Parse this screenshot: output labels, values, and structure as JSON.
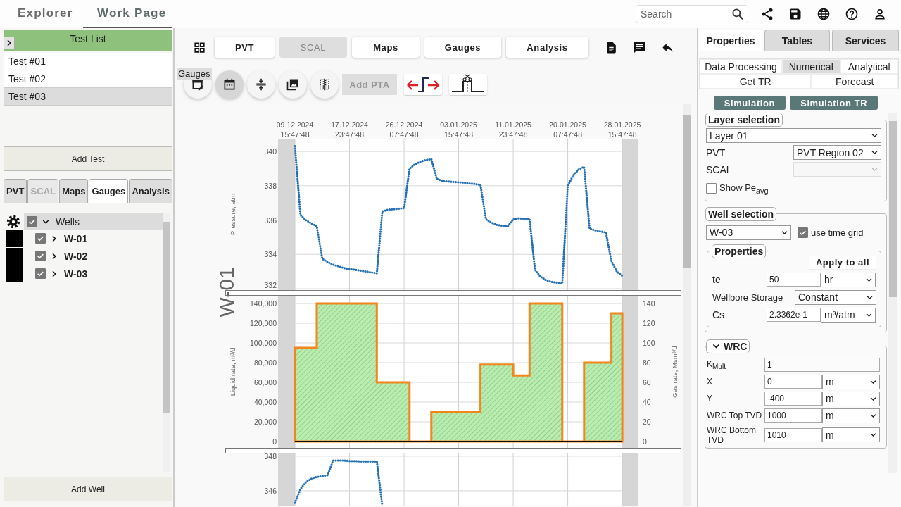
{
  "header": {
    "tabs": [
      {
        "label": "Explorer",
        "selected": false
      },
      {
        "label": "Work Page",
        "selected": true
      }
    ],
    "search": {
      "placeholder": "Search"
    }
  },
  "test_list": {
    "title": "Test List",
    "items": [
      {
        "label": "Test #01",
        "selected": false
      },
      {
        "label": "Test #02",
        "selected": false
      },
      {
        "label": "Test #03",
        "selected": true
      }
    ],
    "add_button": "Add Test"
  },
  "module_tabs": [
    {
      "label": "PVT",
      "selected": false,
      "disabled": false
    },
    {
      "label": "SCAL",
      "selected": false,
      "disabled": true
    },
    {
      "label": "Maps",
      "selected": false,
      "disabled": false
    },
    {
      "label": "Gauges",
      "selected": true,
      "disabled": false
    },
    {
      "label": "Analysis",
      "selected": false,
      "disabled": false
    }
  ],
  "wells_tree": {
    "label": "Wells",
    "checked": true,
    "expanded": true,
    "selected": true,
    "children": [
      {
        "label": "W-01",
        "checked": true,
        "expanded": false,
        "selected": false,
        "color": "#000000"
      },
      {
        "label": "W-02",
        "checked": true,
        "expanded": false,
        "selected": false,
        "color": "#000000"
      },
      {
        "label": "W-03",
        "checked": true,
        "expanded": false,
        "selected": false,
        "color": "#000000"
      }
    ]
  },
  "add_well_button": "Add Well",
  "toolbar": {
    "buttons": [
      {
        "label": "PVT",
        "disabled": false
      },
      {
        "label": "SCAL",
        "disabled": true
      },
      {
        "label": "Maps",
        "disabled": false
      },
      {
        "label": "Gauges",
        "disabled": false
      },
      {
        "label": "Analysis",
        "disabled": false
      }
    ]
  },
  "tool_row": {
    "tooltip": "Gauges",
    "tools": [
      {
        "kind": "edit-calendar",
        "selected": false
      },
      {
        "kind": "calendar",
        "selected": true
      },
      {
        "kind": "compress",
        "selected": false
      },
      {
        "kind": "photos",
        "selected": false
      },
      {
        "kind": "split",
        "selected": false
      },
      {
        "kind": "text",
        "label": "Add PTA",
        "disabled": true
      },
      {
        "kind": "shift"
      },
      {
        "kind": "cut"
      }
    ]
  },
  "plot": {
    "well_label": "W-01",
    "charts": [
      {
        "chart_data": {
          "type": "line",
          "ylabel": "Pressure, atm",
          "categories": [
            "09.12.2024\n15:47:48",
            null,
            null,
            null,
            null,
            null,
            null,
            null,
            null,
            null,
            "17.12.2024\n23:47:48",
            null,
            null,
            null,
            null,
            null,
            null,
            null,
            null,
            null,
            "26.12.2024\n07:47:48",
            null,
            null,
            null,
            null,
            null,
            null,
            null,
            null,
            null,
            "03.01.2025\n15:47:48",
            null,
            null,
            null,
            null,
            null,
            null,
            null,
            null,
            null,
            "11.01.2025\n23:47:48",
            null,
            null,
            null,
            null,
            null,
            null,
            null,
            null,
            null,
            "20.01.2025\n07:47:48",
            null,
            null,
            null,
            null,
            null,
            null,
            null,
            null,
            null,
            "28.01.2025\n15:47:48"
          ],
          "grid": true,
          "series": [
            {
              "color": "#2470b4",
              "line_style": "dotted",
              "values": [
                340.3,
                336.3,
                336.0,
                335.8,
                335.65,
                333.75,
                333.55,
                333.4,
                333.3,
                333.2,
                333.15,
                333.1,
                333.05,
                333.0,
                332.95,
                332.9,
                336.5,
                336.6,
                336.63,
                336.66,
                336.7,
                339.0,
                339.25,
                339.4,
                339.5,
                339.55,
                338.4,
                338.28,
                338.25,
                338.22,
                338.2,
                338.17,
                338.13,
                338.1,
                338.05,
                336.05,
                335.85,
                335.72,
                335.67,
                335.62,
                336.05,
                336.1,
                336.08,
                336.05,
                333.1,
                332.7,
                332.5,
                332.4,
                332.35,
                332.3,
                338.0,
                338.6,
                338.95,
                339.1,
                335.5,
                335.4,
                335.33,
                335.28,
                333.6,
                333.0,
                332.75
              ]
            }
          ],
          "ylim": [
            332,
            340.74
          ],
          "yticks": [
            {
              "value": 332,
              "label": "332"
            },
            {
              "value": 334,
              "label": "334"
            },
            {
              "value": 336,
              "label": "336"
            },
            {
              "value": 338,
              "label": "338"
            },
            {
              "value": 340,
              "label": "340"
            }
          ]
        }
      },
      {
        "chart_data": {
          "type": "area",
          "ylabel": "Liquid rate, m³/d",
          "y2label": "Gas rate, Msm³/d",
          "categories": [
            null,
            null,
            null,
            null,
            null,
            null,
            null,
            null,
            null,
            null,
            null,
            null,
            null,
            null,
            null,
            null,
            null,
            null,
            null,
            null,
            null,
            null,
            null,
            null,
            null,
            null,
            null,
            null,
            null,
            null,
            null,
            null,
            null,
            null,
            null,
            null,
            null,
            null,
            null,
            null,
            null,
            null,
            null,
            null,
            null,
            null,
            null,
            null,
            null,
            null,
            null,
            null,
            null,
            null,
            null,
            null,
            null,
            null,
            null,
            null,
            null
          ],
          "series": [
            {
              "color": "#f0861c",
              "values": [
                95000,
                95000,
                95000,
                95000,
                140000,
                140000,
                140000,
                140000,
                140000,
                140000,
                140000,
                140000,
                140000,
                140000,
                140000,
                60000,
                60000,
                60000,
                60000,
                60000,
                60000,
                0,
                0,
                0,
                0,
                30000,
                30000,
                30000,
                30000,
                30000,
                30000,
                30000,
                30000,
                30000,
                78000,
                78000,
                78000,
                78000,
                78000,
                78000,
                67000,
                67000,
                67000,
                140000,
                140000,
                140000,
                140000,
                140000,
                140000,
                0,
                0,
                0,
                0,
                80000,
                80000,
                80000,
                80000,
                80000,
                130000,
                130000,
                130000
              ]
            }
          ],
          "grid": true,
          "ylim": [
            -6430,
            147860
          ],
          "y2lim": [
            -6.43,
            147.86
          ],
          "yticks": [
            {
              "value": 0,
              "label": "0"
            },
            {
              "value": 20000,
              "label": "20,000"
            },
            {
              "value": 40000,
              "label": "40,000"
            },
            {
              "value": 60000,
              "label": "60,000"
            },
            {
              "value": 80000,
              "label": "80,000"
            },
            {
              "value": 100000,
              "label": "100,000"
            },
            {
              "value": 120000,
              "label": "120,000"
            },
            {
              "value": 140000,
              "label": "140,000"
            }
          ],
          "y2ticks": [
            {
              "value": 0,
              "label": "0"
            },
            {
              "value": 20,
              "label": "20"
            },
            {
              "value": 40,
              "label": "40"
            },
            {
              "value": 60,
              "label": "60"
            },
            {
              "value": 80,
              "label": "80"
            },
            {
              "value": 100,
              "label": "100"
            },
            {
              "value": 120,
              "label": "120"
            },
            {
              "value": 140,
              "label": "140"
            }
          ]
        }
      },
      {
        "chart_data": {
          "type": "line",
          "categories": [
            null,
            null,
            null,
            null,
            null,
            null,
            null,
            null,
            null,
            null,
            null,
            null,
            null,
            null,
            null,
            null,
            null,
            null,
            null,
            null,
            null,
            null,
            null,
            null,
            null,
            null,
            null,
            null,
            null,
            null,
            null,
            null,
            null,
            null,
            null,
            null,
            null,
            null,
            null,
            null,
            null,
            null,
            null,
            null,
            null,
            null,
            null,
            null,
            null,
            null,
            null,
            null,
            null,
            null,
            null,
            null,
            null,
            null,
            null,
            null,
            null
          ],
          "grid": true,
          "series": [
            {
              "color": "#2470b4",
              "line_style": "dotted",
              "values": [
                345.3,
                346.1,
                346.5,
                346.7,
                346.8,
                346.85,
                346.9,
                347.75,
                347.75,
                347.75,
                347.72,
                347.72,
                347.7,
                347.7,
                347.7,
                347.7,
                345.15,
                null,
                null,
                null,
                null,
                null,
                null,
                null,
                null,
                null,
                null,
                null,
                null,
                null,
                null,
                null,
                null,
                null,
                null,
                null,
                null,
                null,
                null,
                null,
                null,
                null,
                null,
                null,
                null,
                null,
                null,
                null,
                null,
                null,
                null,
                null,
                null,
                null,
                null,
                null,
                null,
                null,
                null,
                null,
                null
              ]
            }
          ],
          "ylim": [
            345.14,
            348.16
          ],
          "yticks": [
            {
              "value": 346,
              "label": "346"
            },
            {
              "value": 348,
              "label": "348"
            }
          ]
        }
      }
    ]
  },
  "right_panel": {
    "tabs": [
      {
        "label": "Properties",
        "selected": true
      },
      {
        "label": "Tables",
        "selected": false
      },
      {
        "label": "Services",
        "selected": false
      }
    ],
    "mode_tabs": [
      {
        "label": "Data Processing",
        "selected": false
      },
      {
        "label": "Numerical",
        "selected": true
      },
      {
        "label": "Analytical",
        "selected": false
      },
      {
        "label": "Get TR",
        "selected": false
      },
      {
        "label": "Forecast",
        "selected": false
      }
    ],
    "actions": [
      "Simulation",
      "Simulation TR"
    ],
    "layer_selection": {
      "title": "Layer selection",
      "layer": "Layer 01",
      "fields": [
        {
          "label": "PVT",
          "value": "PVT Region 02",
          "disabled": false
        },
        {
          "label": "SCAL",
          "disabled": true
        }
      ],
      "show_pe": {
        "label": "Show Pe$_{avg}$",
        "checked": false
      }
    },
    "well_selection": {
      "title": "Well selection",
      "well": "W-03",
      "use_time_grid": {
        "label": "use time grid",
        "checked": true
      },
      "properties": {
        "title": "Properties",
        "apply_button": "Apply to all",
        "rows": [
          {
            "kind": "input-unit",
            "label": "te",
            "value": "50",
            "unit": "hr"
          },
          {
            "kind": "select",
            "label": "Wellbore Storage",
            "value": "Constant"
          },
          {
            "kind": "input-unit",
            "label": "Cs",
            "value": "2.3362e-1",
            "unit": "m³/atm"
          }
        ]
      }
    },
    "wrc": {
      "title": "WRC",
      "expanded": true,
      "rows": [
        {
          "kind": "input",
          "label": "K$_{Mult}$",
          "value": "1"
        },
        {
          "kind": "input-unit",
          "label": "X",
          "value": "0",
          "unit": "m"
        },
        {
          "kind": "input-unit",
          "label": "Y",
          "value": "-400",
          "unit": "m"
        },
        {
          "kind": "input-unit",
          "label": "WRC Top TVD",
          "value": "1000",
          "unit": "m"
        },
        {
          "kind": "input-unit",
          "label": "WRC Bottom TVD",
          "value": "1010",
          "unit": "m"
        }
      ]
    }
  }
}
